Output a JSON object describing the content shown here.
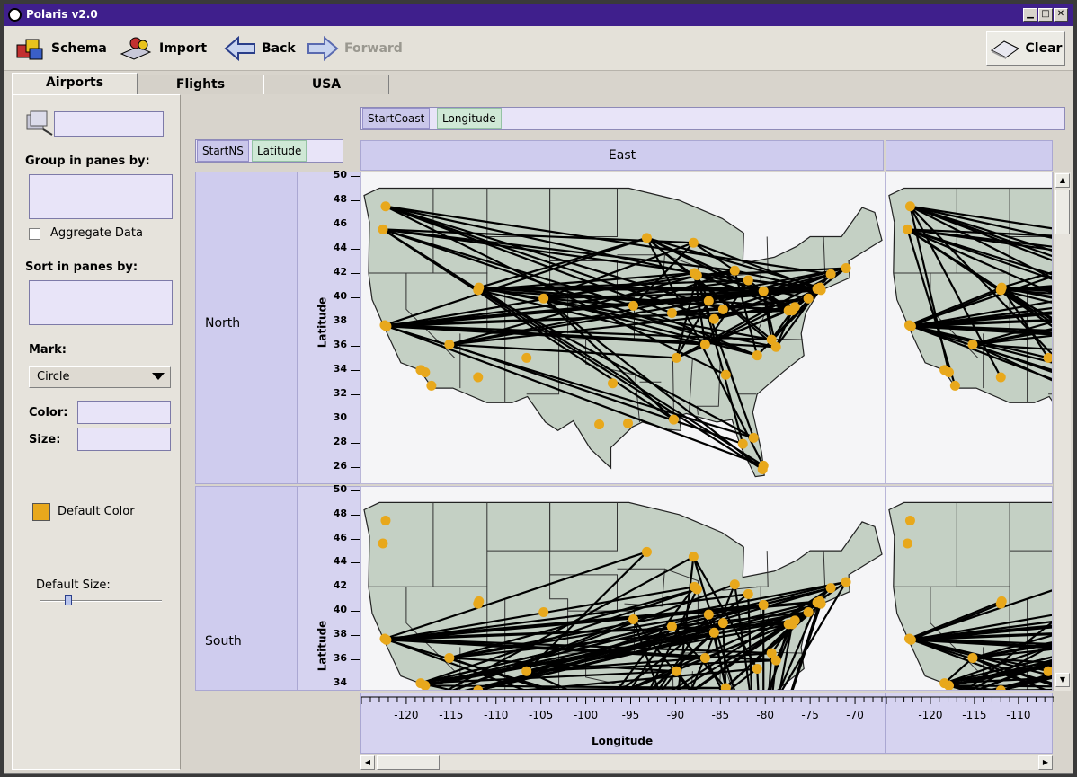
{
  "window": {
    "title": "Polaris v2.0",
    "controls": [
      "minimize",
      "maximize",
      "close"
    ]
  },
  "toolbar": {
    "schema": "Schema",
    "import": "Import",
    "back": "Back",
    "forward": "Forward",
    "clear": "Clear"
  },
  "tabs": [
    {
      "label": "Airports",
      "active": true
    },
    {
      "label": "Flights",
      "active": false
    },
    {
      "label": "USA",
      "active": false
    }
  ],
  "left_panel": {
    "group_label": "Group in panes by:",
    "aggregate_label": "Aggregate Data",
    "aggregate_checked": false,
    "sort_label": "Sort in panes by:",
    "mark_label": "Mark:",
    "mark_value": "Circle",
    "color_label": "Color:",
    "size_label": "Size:",
    "default_color_label": "Default Color",
    "default_color": "#e8a81c",
    "default_size_label": "Default Size:"
  },
  "shelves": {
    "columns": [
      "StartCoast",
      "Longitude"
    ],
    "rows": [
      "StartNS",
      "Latitude"
    ]
  },
  "column_headers": [
    "East",
    ""
  ],
  "row_headers": [
    "North",
    "South"
  ],
  "chart_data": {
    "type": "scatter",
    "description_units": "longitude/latitude",
    "xlabel": "Longitude",
    "ylabel": "Latitude",
    "x_ticks": [
      -120,
      -115,
      -110,
      -105,
      -100,
      -95,
      -90,
      -85,
      -80,
      -75,
      -70
    ],
    "y_ticks_north": [
      26,
      28,
      30,
      32,
      34,
      36,
      38,
      40,
      42,
      44,
      46,
      48,
      50
    ],
    "y_ticks_south": [
      34,
      36,
      38,
      40,
      42,
      44,
      46,
      48,
      50
    ],
    "xlim": [
      -126,
      -66
    ],
    "ylim": [
      24.5,
      50
    ],
    "mark_color": "#e8a81c",
    "line_color": "#000000",
    "airports": [
      [
        -122.3,
        47.5
      ],
      [
        -122.6,
        45.6
      ],
      [
        -122.4,
        37.7
      ],
      [
        -122.2,
        37.6
      ],
      [
        -118.4,
        34.0
      ],
      [
        -117.9,
        33.8
      ],
      [
        -117.2,
        32.7
      ],
      [
        -111.9,
        40.8
      ],
      [
        -112.0,
        40.6
      ],
      [
        -115.2,
        36.1
      ],
      [
        -112.0,
        33.4
      ],
      [
        -104.7,
        39.9
      ],
      [
        -106.6,
        35.0
      ],
      [
        -97.0,
        32.9
      ],
      [
        -95.3,
        29.6
      ],
      [
        -98.5,
        29.5
      ],
      [
        -90.2,
        29.9
      ],
      [
        -93.2,
        44.9
      ],
      [
        -87.9,
        42.0
      ],
      [
        -87.6,
        41.8
      ],
      [
        -84.4,
        33.6
      ],
      [
        -80.3,
        25.8
      ],
      [
        -80.2,
        26.1
      ],
      [
        -81.3,
        28.4
      ],
      [
        -82.5,
        27.9
      ],
      [
        -84.7,
        39.0
      ],
      [
        -83.4,
        42.2
      ],
      [
        -80.2,
        40.5
      ],
      [
        -81.9,
        41.4
      ],
      [
        -86.3,
        39.7
      ],
      [
        -90.4,
        38.7
      ],
      [
        -94.7,
        39.3
      ],
      [
        -77.0,
        38.9
      ],
      [
        -77.4,
        38.9
      ],
      [
        -76.7,
        39.2
      ],
      [
        -75.2,
        39.9
      ],
      [
        -73.8,
        40.6
      ],
      [
        -73.9,
        40.8
      ],
      [
        -74.2,
        40.7
      ],
      [
        -71.0,
        42.4
      ],
      [
        -72.7,
        41.9
      ],
      [
        -80.9,
        35.2
      ],
      [
        -78.8,
        35.9
      ],
      [
        -86.7,
        36.1
      ],
      [
        -89.9,
        35.0
      ],
      [
        -85.7,
        38.2
      ],
      [
        -88.0,
        44.5
      ],
      [
        -79.3,
        36.5
      ]
    ]
  }
}
